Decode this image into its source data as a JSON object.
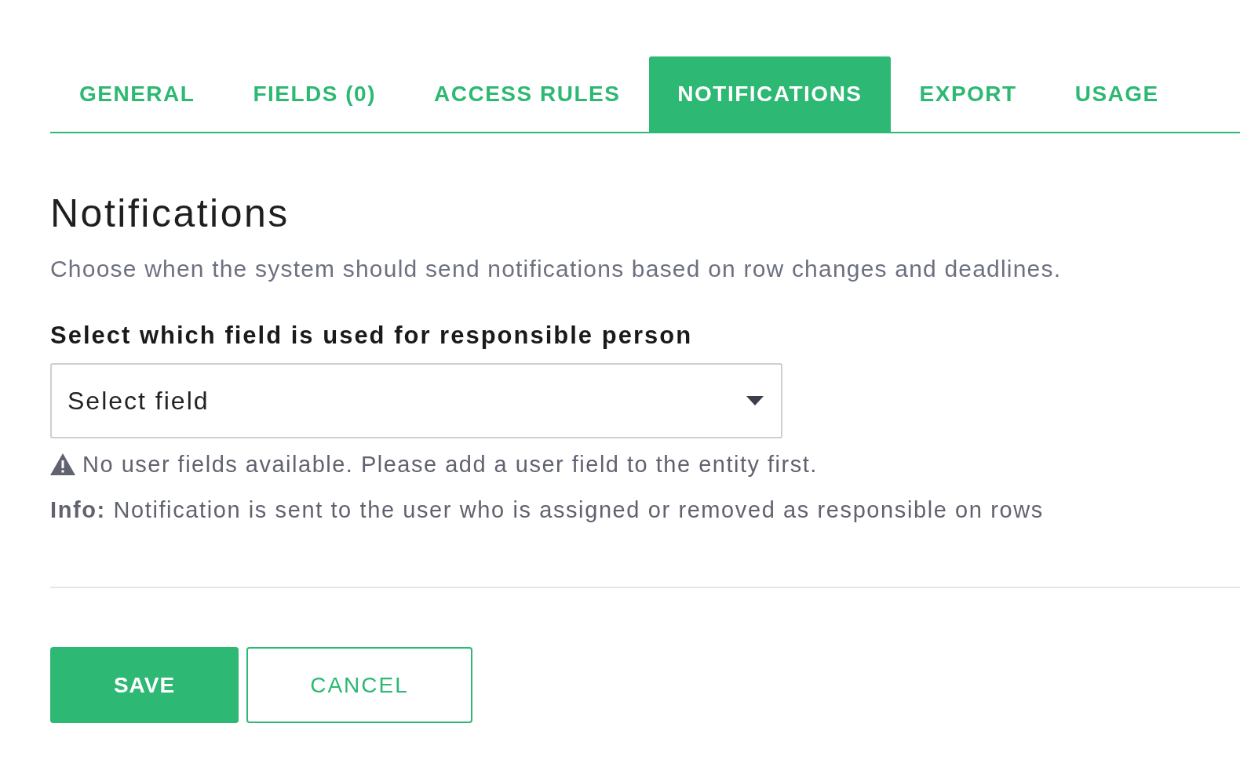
{
  "tabs": [
    {
      "label": "GENERAL",
      "selected": false
    },
    {
      "label": "FIELDS (0)",
      "selected": false
    },
    {
      "label": "ACCESS RULES",
      "selected": false
    },
    {
      "label": "NOTIFICATIONS",
      "selected": true
    },
    {
      "label": "EXPORT",
      "selected": false
    },
    {
      "label": "USAGE",
      "selected": false
    }
  ],
  "section": {
    "title": "Notifications",
    "description": "Choose when the system should send notifications based on row changes and deadlines."
  },
  "responsible_field": {
    "label": "Select which field is used for responsible person",
    "value": "Select field",
    "warning": "No user fields available. Please add a user field to the entity first.",
    "info": "**Info:** Notification is sent to the user who is assigned or removed as responsible on rows"
  },
  "buttons": [
    {
      "label": "SAVE",
      "kind": "primary"
    },
    {
      "label": "CANCEL",
      "kind": "secondary"
    }
  ]
}
